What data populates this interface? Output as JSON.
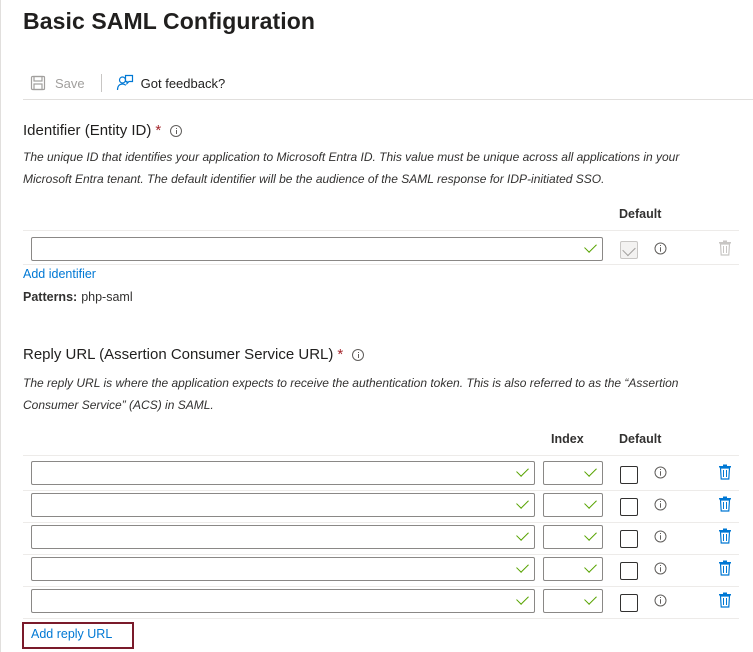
{
  "page": {
    "title": "Basic SAML Configuration"
  },
  "toolbar": {
    "save_label": "Save",
    "feedback_label": "Got feedback?"
  },
  "identifier": {
    "label": "Identifier (Entity ID)",
    "required": "*",
    "description": "The unique ID that identifies your application to Microsoft Entra ID. This value must be unique across all applications in your Microsoft Entra tenant. The default identifier will be the audience of the SAML response for IDP-initiated SSO.",
    "default_header": "Default",
    "add_link": "Add identifier",
    "patterns_label": "Patterns:",
    "patterns_value": "php-saml",
    "rows": [
      {
        "value": "",
        "default_checked": true
      }
    ]
  },
  "reply_url": {
    "label": "Reply URL (Assertion Consumer Service URL)",
    "required": "*",
    "description": "The reply URL is where the application expects to receive the authentication token. This is also referred to as the “Assertion Consumer Service” (ACS) in SAML.",
    "index_header": "Index",
    "default_header": "Default",
    "add_link": "Add reply URL",
    "rows": [
      {
        "url": "",
        "index": "",
        "default_checked": false
      },
      {
        "url": "",
        "index": "",
        "default_checked": false
      },
      {
        "url": "",
        "index": "",
        "default_checked": false
      },
      {
        "url": "",
        "index": "",
        "default_checked": false
      },
      {
        "url": "",
        "index": "",
        "default_checked": false
      }
    ]
  },
  "colors": {
    "link": "#0078d4",
    "valid_check": "#57a300",
    "required": "#a4262c",
    "highlight": "#7a1a2a"
  },
  "icons": {
    "save": "save-icon",
    "feedback": "feedback-icon",
    "info": "info-icon",
    "delete": "trash-icon"
  }
}
